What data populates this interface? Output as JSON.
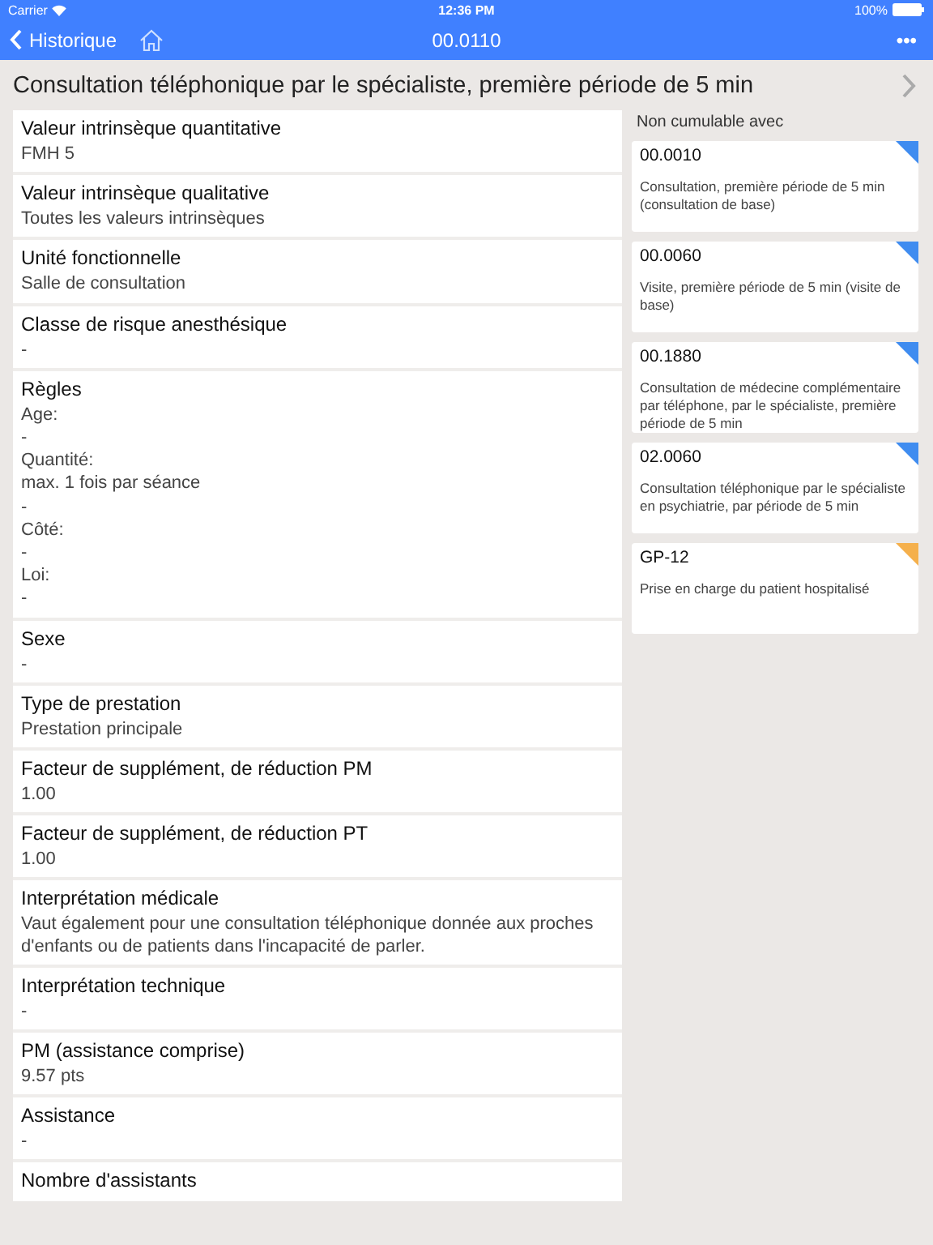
{
  "status_bar": {
    "carrier": "Carrier",
    "time": "12:36 PM",
    "battery": "100%"
  },
  "nav": {
    "back": "Historique",
    "title": "00.0110",
    "more": "•••"
  },
  "heading": "Consultation téléphonique par le spécialiste, première période de 5 min",
  "fields": [
    {
      "label": "Valeur intrinsèque quantitative",
      "lines": [
        "FMH 5"
      ]
    },
    {
      "label": "Valeur intrinsèque qualitative",
      "lines": [
        "Toutes les valeurs intrinsèques"
      ]
    },
    {
      "label": "Unité fonctionnelle",
      "lines": [
        "Salle de consultation"
      ]
    },
    {
      "label": "Classe de risque anesthésique",
      "lines": [
        "-"
      ]
    },
    {
      "label": "Règles",
      "lines": [
        "Age:",
        "-",
        "Quantité:",
        "max. 1 fois par séance",
        "-",
        "Côté:",
        "-",
        "Loi:",
        "-"
      ]
    },
    {
      "label": "Sexe",
      "lines": [
        "-"
      ]
    },
    {
      "label": "Type de prestation",
      "lines": [
        "Prestation principale"
      ]
    },
    {
      "label": "Facteur de supplément, de réduction PM",
      "lines": [
        "1.00"
      ]
    },
    {
      "label": "Facteur de supplément, de réduction PT",
      "lines": [
        "1.00"
      ]
    },
    {
      "label": "Interprétation médicale",
      "lines": [
        "Vaut également pour une consultation téléphonique donnée aux proches d'enfants ou de patients dans l'incapacité de parler."
      ]
    },
    {
      "label": "Interprétation technique",
      "lines": [
        "-"
      ]
    },
    {
      "label": "PM (assistance comprise)",
      "lines": [
        "9.57 pts"
      ]
    },
    {
      "label": "Assistance",
      "lines": [
        "-"
      ]
    },
    {
      "label": "Nombre d'assistants"
    }
  ],
  "side_title": "Non cumulable avec",
  "cards": [
    {
      "code": "00.0010",
      "text": "Consultation, première période de 5 min (consultation de base)",
      "color": "#3f8cf0"
    },
    {
      "code": "00.0060",
      "text": "Visite, première période de 5 min (visite de base)",
      "color": "#3f8cf0"
    },
    {
      "code": "00.1880",
      "text": "Consultation de médecine complémentaire par téléphone, par le spécialiste, première période de 5 min",
      "color": "#3f8cf0"
    },
    {
      "code": "02.0060",
      "text": "Consultation téléphonique par le spécialiste en psychiatrie, par période de 5 min",
      "color": "#3f8cf0"
    },
    {
      "code": "GP-12",
      "text": "Prise en charge du patient hospitalisé",
      "color": "#f5b04c"
    }
  ]
}
